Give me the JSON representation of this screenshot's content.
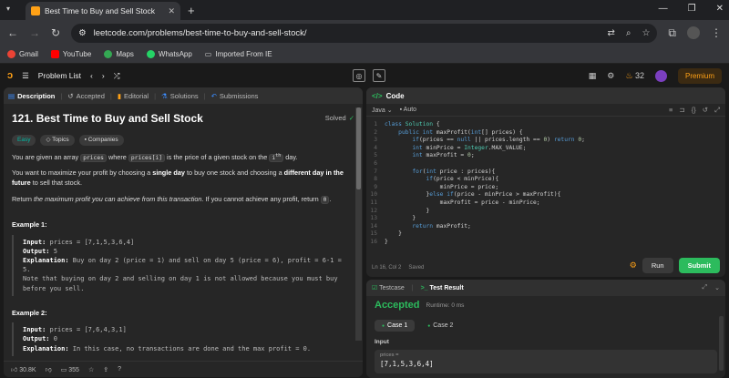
{
  "browser": {
    "tab_title": "Best Time to Buy and Sell Stock",
    "url": "leetcode.com/problems/best-time-to-buy-and-sell-stock/",
    "bookmarks": [
      "Gmail",
      "YouTube",
      "Maps",
      "WhatsApp",
      "Imported From IE"
    ]
  },
  "nav": {
    "problem_list": "Problem List",
    "streak": "32",
    "premium": "Premium"
  },
  "desc_tabs": [
    "Description",
    "Accepted",
    "Editorial",
    "Solutions",
    "Submissions"
  ],
  "problem": {
    "title": "121. Best Time to Buy and Sell Stock",
    "solved": "Solved",
    "tags": [
      "Easy",
      "Topics",
      "Companies"
    ],
    "p1_a": "You are given an array ",
    "p1_code1": "prices",
    "p1_b": " where ",
    "p1_code2": "prices[i]",
    "p1_c": " is the price of a given stock on the ",
    "p1_code3": "i",
    "p1_sup": "th",
    "p1_d": " day.",
    "p2_a": "You want to maximize your profit by choosing a ",
    "p2_b1": "single day",
    "p2_c": " to buy one stock and choosing a ",
    "p2_b2": "different day in the future",
    "p2_d": " to sell that stock.",
    "p3_a": "Return ",
    "p3_em": "the maximum profit you can achieve from this transaction",
    "p3_b": ". If you cannot achieve any profit, return ",
    "p3_code": "0",
    "p3_c": ".",
    "ex1_title": "Example 1:",
    "ex1_input_label": "Input:",
    "ex1_input": " prices = [7,1,5,3,6,4]",
    "ex1_output_label": "Output:",
    "ex1_output": " 5",
    "ex1_expl_label": "Explanation:",
    "ex1_expl": " Buy on day 2 (price = 1) and sell on day 5 (price = 6), profit = 6-1 =",
    "ex1_expl2": "5.",
    "ex1_note": "Note that buying on day 2 and selling on day 1 is not allowed because you must buy",
    "ex1_note2": "before you sell.",
    "ex2_title": "Example 2:",
    "ex2_input_label": "Input:",
    "ex2_input": " prices = [7,6,4,3,1]",
    "ex2_output_label": "Output:",
    "ex2_output": " 0",
    "ex2_expl_label": "Explanation:",
    "ex2_expl": " In this case, no transactions are done and the max profit = 0."
  },
  "footer": {
    "likes": "30.8K",
    "comments": "355"
  },
  "code": {
    "title": "Code",
    "language": "Java",
    "mode": "Auto",
    "lines": [
      "class Solution {",
      "    public int maxProfit(int[] prices) {",
      "        if(prices == null || prices.length == 0) return 0;",
      "        int minPrice = Integer.MAX_VALUE;",
      "        int maxProfit = 0;",
      "",
      "        for(int price : prices){",
      "            if(price < minPrice){",
      "                minPrice = price;",
      "            }else if(price - minPrice > maxProfit){",
      "                maxProfit = price - minPrice;",
      "            }",
      "        }",
      "        return maxProfit;",
      "    }",
      "}"
    ],
    "cursor": "Ln 16, Col 2",
    "saved": "Saved",
    "run": "Run",
    "submit": "Submit"
  },
  "result": {
    "tab_testcase": "Testcase",
    "tab_result": "Test Result",
    "status": "Accepted",
    "runtime": "Runtime: 0 ms",
    "cases": [
      "Case 1",
      "Case 2"
    ],
    "input_label": "Input",
    "var": "prices =",
    "value": "[7,1,5,3,6,4]"
  }
}
